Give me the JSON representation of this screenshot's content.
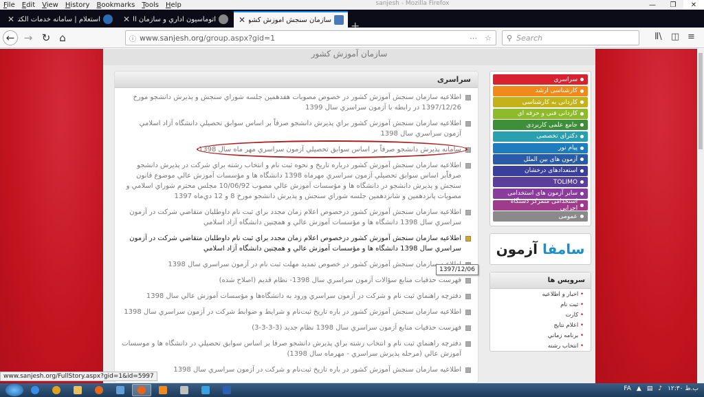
{
  "menu": [
    "File",
    "Edit",
    "View",
    "History",
    "Bookmarks",
    "Tools",
    "Help"
  ],
  "window_caption": "sanjesh - Mozilla Firefox",
  "tabs": [
    {
      "title": "استعلام | سامانه خدمات الکترونیک",
      "icon_color": "#2b6cb0",
      "active": false
    },
    {
      "title": "اتوماسیون اداري و سازمان الکترونیک",
      "icon_color": "#888888",
      "active": false
    },
    {
      "title": "سازمان سنجش آموزش کشور",
      "icon_color": "#4a7ab5",
      "active": true
    }
  ],
  "url": {
    "host": "www.sanjesh.org",
    "path": "/group.aspx?gid=1"
  },
  "search_placeholder": "Search",
  "icons": {
    "back": "back-arrow-icon",
    "forward": "forward-arrow-icon",
    "reload": "reload-icon",
    "home": "home-icon",
    "library": "library-icon",
    "sidebar": "sidebar-icon",
    "menu": "hamburger-icon"
  },
  "banner_text": "سازمان آموزش کشور",
  "main": {
    "heading": "سراسری",
    "news": [
      "اطلاعيه سازمان سنجش آموزش كشور در خصوص مصوبات هفدهمين جلسه شوراي سنجش و پذيرش دانشجو مورخ 1397/12/26 در رابطه با آزمون سراسري سال 1399",
      "اطلاعيه سازمان سنجش آموزش كشور براي پذيرش دانشجو صرفاً بر اساس سوابق تحصيلي دانشگاه آزاد اسلامي آزمون سراسري سال 1398",
      "سامانه پذيرش دانشجو صرفاً بر اساس سوابق تحصيلي آزمون سراسري مهر ماه سال 1398",
      "اطلاعيه سازمان سنجش آموزش كشور درباره تاريخ و نحوه ثبت نام و انتخاب رشته براي شركت در پذيرش دانشجو صرفاًبر اساس سوابق تحصيلي آزمون سراسري مهرماه 1398 دانشگاه ها و مؤسسات آموزش عالي موضوع قانون سنجش و پذيرش دانشجو در دانشگاه ها و مؤسسات آموزش عالي مصوب 10/06/92 مجلس محترم شوراي اسلامي و مصوبات پانزدهمين و شانزدهمين جلسه شوراي سنجش و پذيرش دانشجو مورخ 8 و 12 دي‌ماه 1397",
      "اطلاعيه سازمان سنجش آموزش كشور درخصوص اعلام زمان مجدد براي ثبت نام داوطلبان متقاضي شركت در آزمون سراسري سال 1398 دانشگاه ها و مؤسسات آموزش عالي و همچنين دانشگاه آزاد اسلامي",
      "اطلاعيه سازمان سنجش آموزش كشور درخصوص اعلام زمان مجدد براي ثبت نام داوطلبان متقاضي شركت در آزمون سراسري سال 1398 دانشگاه ها و مؤسسات آموزش عالي و همچنين دانشگاه آزاد اسلامي",
      "اطلاعيه سازمان سنجش آموزش كشور در خصوص تمديد مهلت ثبت نام در آزمون سراسري سال 1398",
      "فهرست حذفيات منابع سؤالات آزمون سراسري سال 1398- نظام قديم (اصلاح شده)",
      "دفترچه راهنماي ثبت نام و شركت در آزمون سراسري ورود به دانشگاه‌ها و مؤسسات آموزش عالي سال 1398",
      "اطلاعيه سازمان سنجش آموزش كشور در باره تاريخ ثبت‌نام و شرايط و ضوابط شركت در آزمون سراسري  سال 1398",
      "فهرست حذفيات منابع آزمون سراسري سال 1398 نظام جديد (3-3-3-3)",
      "دفترچه راهنماي ثبت نام و انتخاب رشته براي پذيرش دانشجو صرفا بر اساس سوابق تحصيلي در دانشگاه ها و موسسات آموزش عالي (مرحله پذيرش سراسري - مهرماه سال 1398)",
      "اطلاعيه سازمان سنجش آموزش كشور در باره تاريخ ثبت‌نام و شركت در آزمون سراسري سال 1398"
    ],
    "tooltip": "1397/12/06"
  },
  "side_menu": [
    {
      "label": "سراسری",
      "color": "#d8222f"
    },
    {
      "label": "کارشناسی ارشد",
      "color": "#f08a1d"
    },
    {
      "label": "کاردانی به کارشناسی",
      "color": "#c4b21a"
    },
    {
      "label": "کاردانی فنی و حرفه ای",
      "color": "#8dbb2a"
    },
    {
      "label": "جامع علمی کاربردی",
      "color": "#3e8e3a"
    },
    {
      "label": "دکترای تخصصی",
      "color": "#2a9fb0"
    },
    {
      "label": "پیام نور",
      "color": "#1f7dbf"
    },
    {
      "label": "آزمون های بین الملل",
      "color": "#2a5aa8"
    },
    {
      "label": "استعدادهای درخشان",
      "color": "#3b3f9c"
    },
    {
      "label": "TOLIMO",
      "color": "#5a3f9c"
    },
    {
      "label": "سایر آزمون های استخدامی",
      "color": "#8a3c9e"
    },
    {
      "label": "استخدامی متمرکز دستگاه اجرایی",
      "color": "#a03a8a"
    },
    {
      "label": "عمومی",
      "color": "#8a8a8a"
    }
  ],
  "logo": {
    "part1": "آزمون",
    "part2": "سامفا"
  },
  "services": {
    "heading": "سرويس ها",
    "items": [
      "اخبار و اطلاعيه",
      "ثبت نام",
      "كارت",
      "اعلام نتايج",
      "برنامه زماني",
      "انتخاب رشته"
    ]
  },
  "status_url": "www.sanjesh.org/FullStory.aspx?gid=1&id=5997",
  "taskbar": {
    "apps": [
      {
        "icon": "ie-icon",
        "color": "#3a8ee6"
      },
      {
        "icon": "chrome-icon",
        "color": "#e0a020"
      },
      {
        "icon": "explorer-folder-icon",
        "color": "#e8c060"
      },
      {
        "icon": "media-player-icon",
        "color": "#e06a1a"
      },
      {
        "icon": "network-icon",
        "color": "#5fa0d8"
      },
      {
        "icon": "firefox-icon",
        "color": "#e8641a"
      },
      {
        "icon": "vlc-icon",
        "color": "#f08a1d"
      },
      {
        "icon": "calculator-icon",
        "color": "#c0c0c0"
      },
      {
        "icon": "paint-icon",
        "color": "#3aa0e0"
      },
      {
        "icon": "word-icon",
        "color": "#2b5fb0"
      }
    ],
    "lang": "FA",
    "time": "۱۲:۳۰ ب.ظ"
  }
}
